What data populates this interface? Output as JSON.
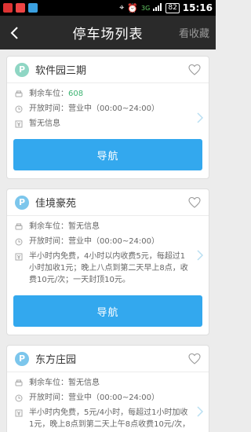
{
  "status_bar": {
    "battery": "82",
    "time": "15:16",
    "network": "3G"
  },
  "header": {
    "back_icon": "chevron-left-icon",
    "title": "停车场列表",
    "favorites_label": "看收藏"
  },
  "labels": {
    "spaces": "剩余车位：",
    "hours": "开放时间：",
    "nav": "导航"
  },
  "cards": [
    {
      "badge": "P",
      "name": "软件园三期",
      "spaces": "608",
      "hours": "营业中（00:00~24:00）",
      "fee": "暂无信息"
    },
    {
      "badge": "P",
      "name": "佳境豪苑",
      "spaces": "暂无信息",
      "hours": "营业中（00:00~24:00）",
      "fee": "半小时内免费，4小时以内收费5元，每超过1小时加收1元；晚上八点到第二天早上8点，收费10元/次；一天封顶10元。"
    },
    {
      "badge": "P",
      "name": "东方庄园",
      "spaces": "暂无信息",
      "hours": "营业中（00:00~24:00）",
      "fee": "半小时内免费，5元/4小时，每超过1小时加收1元，晚上8点到第二天上午8点收费10元/次，一"
    }
  ],
  "colors": {
    "header_bg": "#2a2a2a",
    "nav_button": "#33a8ee",
    "spaces_green": "#3cb371"
  }
}
